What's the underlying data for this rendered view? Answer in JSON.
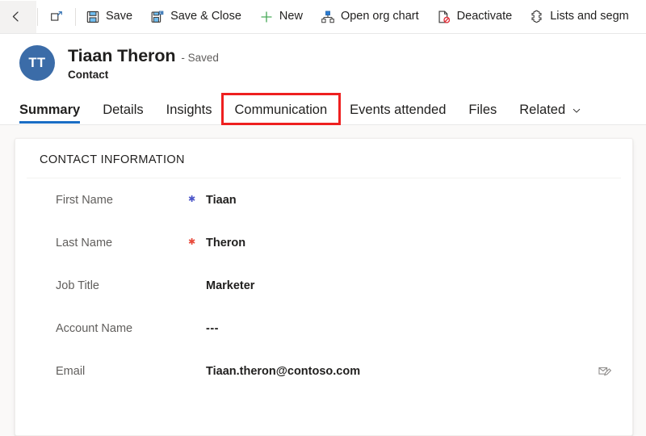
{
  "command_bar": {
    "items": [
      {
        "name": "back",
        "icon": "back-arrow-icon",
        "label": ""
      },
      {
        "name": "popout",
        "icon": "open-in-new-window-icon",
        "label": ""
      },
      {
        "name": "save",
        "icon": "save-icon",
        "label": "Save"
      },
      {
        "name": "save-and-close",
        "icon": "save-and-close-icon",
        "label": "Save & Close"
      },
      {
        "name": "new",
        "icon": "plus-icon",
        "label": "New"
      },
      {
        "name": "open-org-chart",
        "icon": "org-chart-icon",
        "label": "Open org chart"
      },
      {
        "name": "deactivate",
        "icon": "deactivate-icon",
        "label": "Deactivate"
      },
      {
        "name": "lists-and-segments",
        "icon": "puzzle-piece-icon",
        "label": "Lists and segm"
      }
    ]
  },
  "record_header": {
    "avatar_initials": "TT",
    "title": "Tiaan Theron",
    "state": "- Saved",
    "entity": "Contact",
    "avatar_color": "#3b6ca8"
  },
  "tabs": {
    "active_index": 0,
    "highlighted_index": 3,
    "highlight_color": "#ee2020",
    "active_underline_color": "#1a6dc4",
    "items": [
      {
        "label": "Summary",
        "chevron": false
      },
      {
        "label": "Details",
        "chevron": false
      },
      {
        "label": "Insights",
        "chevron": false
      },
      {
        "label": "Communication",
        "chevron": false
      },
      {
        "label": "Events attended",
        "chevron": false
      },
      {
        "label": "Files",
        "chevron": false
      },
      {
        "label": "Related",
        "chevron": true
      }
    ]
  },
  "contact_section": {
    "title": "CONTACT INFORMATION",
    "fields": [
      {
        "label": "First Name",
        "required": "recommended",
        "value": "Tiaan",
        "action_icon": ""
      },
      {
        "label": "Last Name",
        "required": "required",
        "value": "Theron",
        "action_icon": ""
      },
      {
        "label": "Job Title",
        "required": "none",
        "value": "Marketer",
        "action_icon": ""
      },
      {
        "label": "Account Name",
        "required": "none",
        "value": "---",
        "action_icon": ""
      },
      {
        "label": "Email",
        "required": "none",
        "value": "Tiaan.theron@contoso.com",
        "action_icon": "compose-email-icon"
      }
    ]
  }
}
